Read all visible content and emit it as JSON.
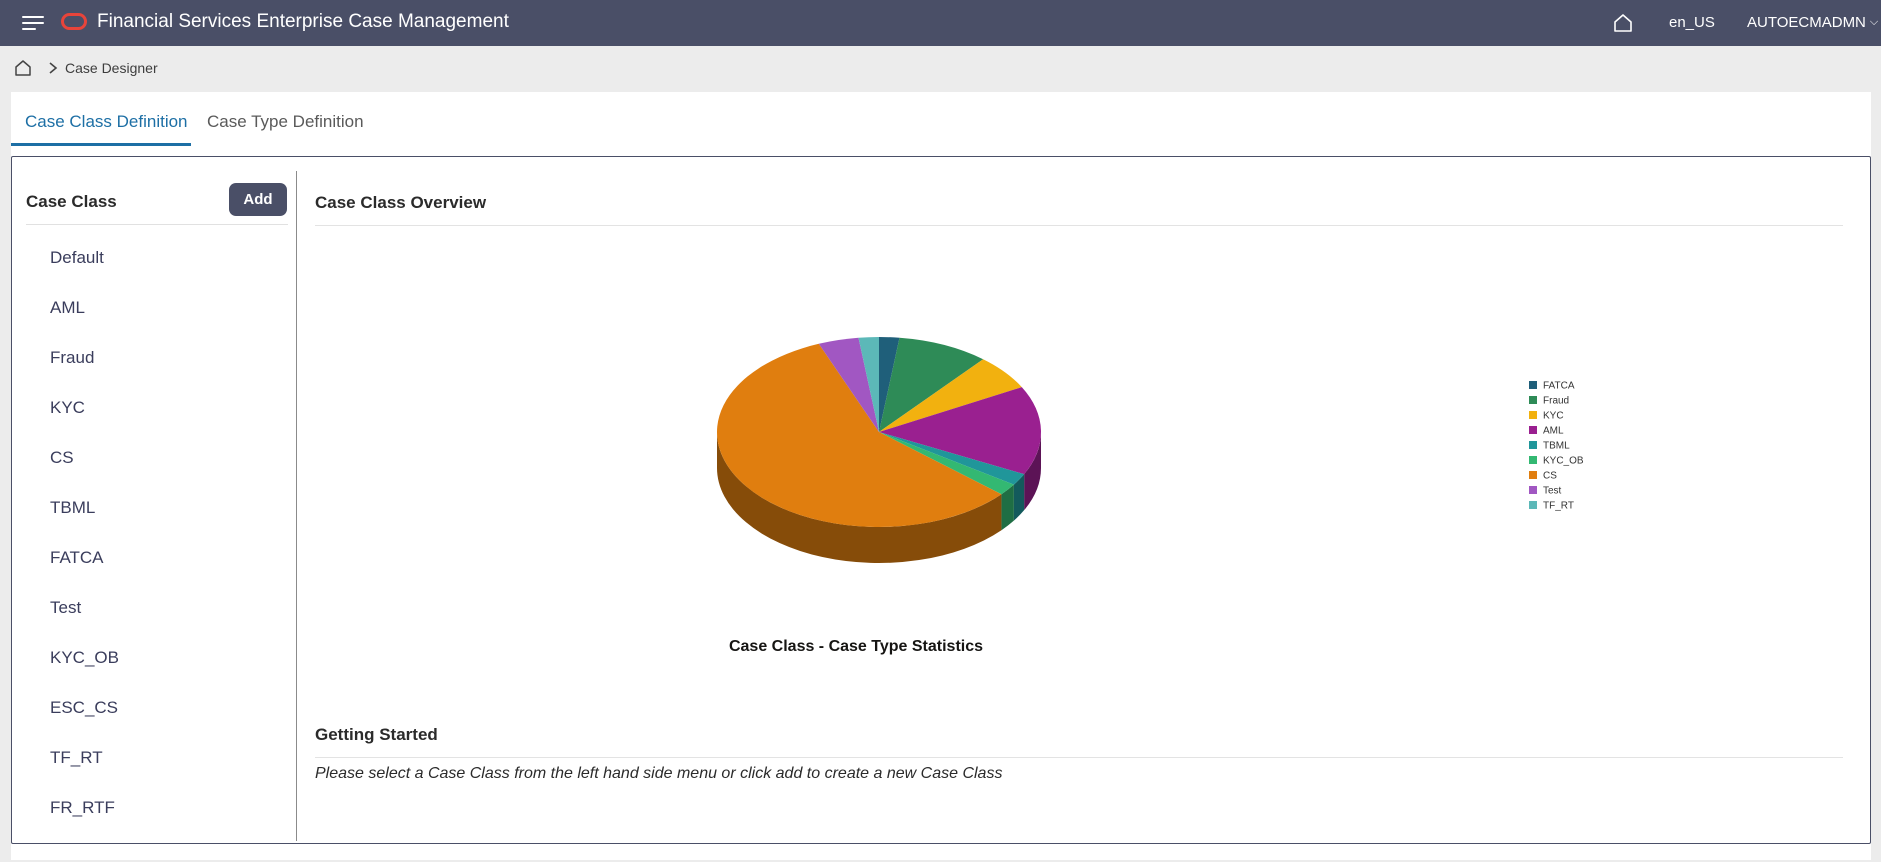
{
  "header": {
    "title": "Financial Services Enterprise Case Management",
    "locale": "en_US",
    "user": "AUTOECMADMN",
    "icons": [
      "hamburger-menu-icon",
      "oracle-logo",
      "home-icon",
      "chevron-down-icon"
    ]
  },
  "breadcrumb": {
    "current": "Case Designer"
  },
  "tabs": [
    {
      "label": "Case Class Definition",
      "active": true
    },
    {
      "label": "Case Type Definition",
      "active": false
    }
  ],
  "sidebar": {
    "title": "Case Class",
    "add_label": "Add",
    "items": [
      "Default",
      "AML",
      "Fraud",
      "KYC",
      "CS",
      "TBML",
      "FATCA",
      "Test",
      "KYC_OB",
      "ESC_CS",
      "TF_RT",
      "FR_RTF"
    ]
  },
  "main": {
    "overview_title": "Case Class Overview",
    "getting_started_title": "Getting Started",
    "getting_started_text": "Please select a Case Class from the left hand side menu or click add to create a new Case Class"
  },
  "chart_data": {
    "type": "pie",
    "style": "3d",
    "title": "Case Class - Case Type Statistics",
    "legend_position": "right",
    "categories": [
      "FATCA",
      "Fraud",
      "KYC",
      "AML",
      "TBML",
      "KYC_OB",
      "CS",
      "Test",
      "TF_RT"
    ],
    "values": [
      2,
      9,
      6,
      15,
      2,
      2,
      57,
      4,
      2
    ],
    "colors": [
      "#1f5f7a",
      "#2e8b57",
      "#f2b10f",
      "#9a2090",
      "#20969a",
      "#33b872",
      "#e07e0f",
      "#a157c2",
      "#5cb8b8"
    ]
  }
}
